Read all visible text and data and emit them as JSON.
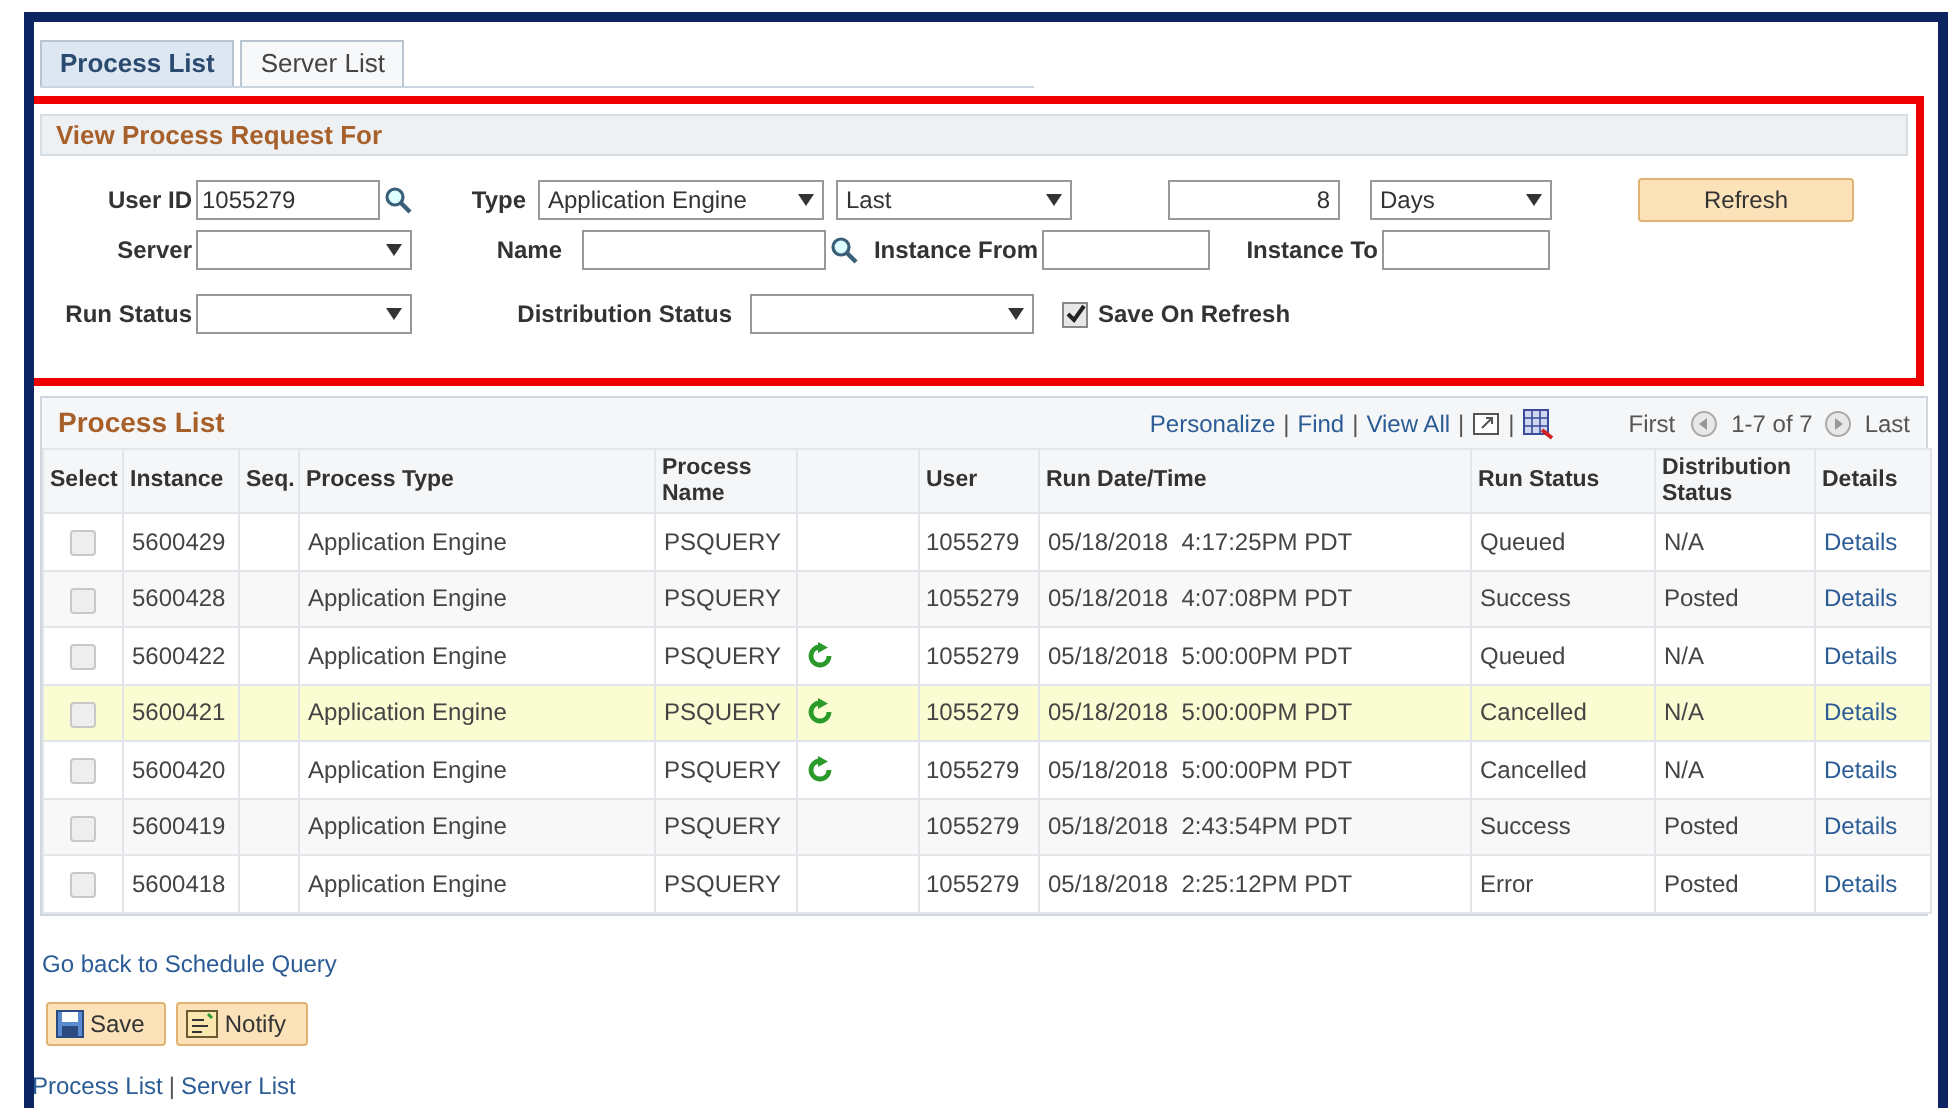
{
  "tabs": [
    {
      "label": "Process List",
      "selected": true
    },
    {
      "label": "Server List",
      "selected": false
    }
  ],
  "filter_panel": {
    "title": "View Process Request For",
    "user_id": {
      "label": "User ID",
      "value": "1055279"
    },
    "type": {
      "label": "Type",
      "value": "Application Engine"
    },
    "period": {
      "value": "Last"
    },
    "amount": {
      "value": "8"
    },
    "unit": {
      "value": "Days"
    },
    "refresh_button": "Refresh",
    "server": {
      "label": "Server"
    },
    "name": {
      "label": "Name"
    },
    "instance_from": {
      "label": "Instance From"
    },
    "instance_to": {
      "label": "Instance To"
    },
    "run_status": {
      "label": "Run Status"
    },
    "distribution_status": {
      "label": "Distribution Status"
    },
    "save_on_refresh": {
      "label": "Save On Refresh",
      "checked": true
    }
  },
  "process_list": {
    "title": "Process List",
    "links": [
      "Personalize",
      "Find",
      "View All"
    ],
    "separator": "|",
    "first": "First",
    "range": "1-7 of 7",
    "last": "Last",
    "columns": [
      "Select",
      "Instance",
      "Seq.",
      "Process Type",
      "Process Name",
      "",
      "User",
      "Run Date/Time",
      "Run Status",
      "Distribution Status",
      "Details"
    ],
    "rows": [
      {
        "checked": false,
        "instance": "5600429",
        "seq": "",
        "process_type": "Application Engine",
        "process_name": "PSQUERY",
        "recurring": false,
        "user": "1055279",
        "run_date_time": "05/18/2018  4:17:25PM PDT",
        "run_status": "Queued",
        "distribution_status": "N/A",
        "details": "Details",
        "selected": false
      },
      {
        "checked": false,
        "instance": "5600428",
        "seq": "",
        "process_type": "Application Engine",
        "process_name": "PSQUERY",
        "recurring": false,
        "user": "1055279",
        "run_date_time": "05/18/2018  4:07:08PM PDT",
        "run_status": "Success",
        "distribution_status": "Posted",
        "details": "Details",
        "selected": false
      },
      {
        "checked": false,
        "instance": "5600422",
        "seq": "",
        "process_type": "Application Engine",
        "process_name": "PSQUERY",
        "recurring": true,
        "user": "1055279",
        "run_date_time": "05/18/2018  5:00:00PM PDT",
        "run_status": "Queued",
        "distribution_status": "N/A",
        "details": "Details",
        "selected": false
      },
      {
        "checked": false,
        "instance": "5600421",
        "seq": "",
        "process_type": "Application Engine",
        "process_name": "PSQUERY",
        "recurring": true,
        "user": "1055279",
        "run_date_time": "05/18/2018  5:00:00PM PDT",
        "run_status": "Cancelled",
        "distribution_status": "N/A",
        "details": "Details",
        "selected": true
      },
      {
        "checked": false,
        "instance": "5600420",
        "seq": "",
        "process_type": "Application Engine",
        "process_name": "PSQUERY",
        "recurring": true,
        "user": "1055279",
        "run_date_time": "05/18/2018  5:00:00PM PDT",
        "run_status": "Cancelled",
        "distribution_status": "N/A",
        "details": "Details",
        "selected": false
      },
      {
        "checked": false,
        "instance": "5600419",
        "seq": "",
        "process_type": "Application Engine",
        "process_name": "PSQUERY",
        "recurring": false,
        "user": "1055279",
        "run_date_time": "05/18/2018  2:43:54PM PDT",
        "run_status": "Success",
        "distribution_status": "Posted",
        "details": "Details",
        "selected": false
      },
      {
        "checked": false,
        "instance": "5600418",
        "seq": "",
        "process_type": "Application Engine",
        "process_name": "PSQUERY",
        "recurring": false,
        "user": "1055279",
        "run_date_time": "05/18/2018  2:25:12PM PDT",
        "run_status": "Error",
        "distribution_status": "Posted",
        "details": "Details",
        "selected": false
      }
    ]
  },
  "back_link": "Go back to Schedule Query",
  "buttons": [
    "Save",
    "Notify"
  ],
  "footer_links": [
    "Process List",
    "Server List"
  ],
  "footer_separator": "|"
}
